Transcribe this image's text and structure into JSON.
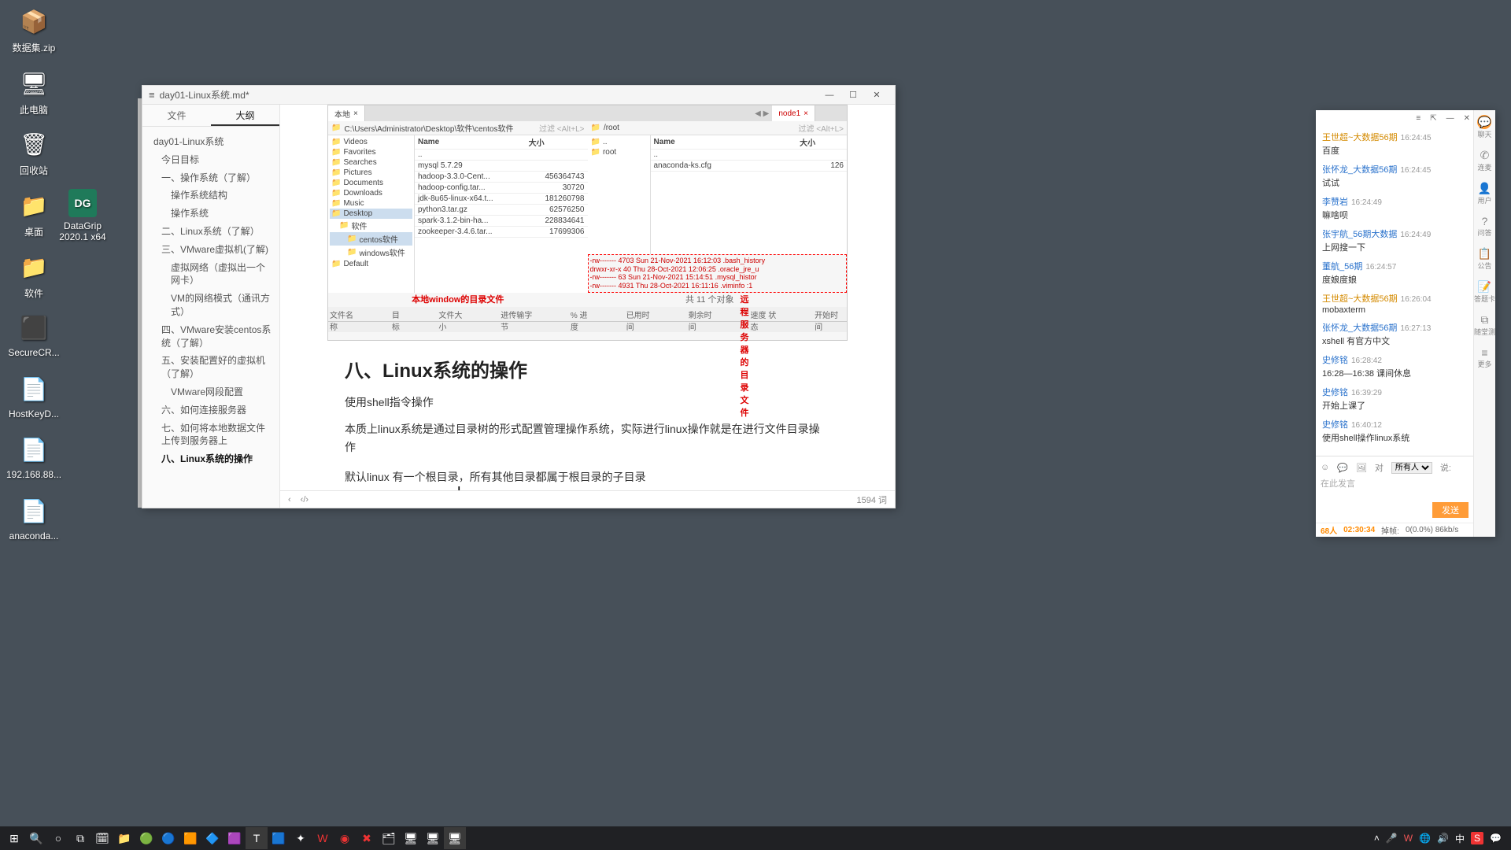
{
  "desktop": {
    "icons": [
      {
        "label": "数据集.zip",
        "glyph": "📦"
      },
      {
        "label": "此电脑",
        "glyph": "🖥"
      },
      {
        "label": "回收站",
        "glyph": "🗑"
      },
      {
        "label": "软件",
        "glyph": "📁"
      },
      {
        "label": "SecureCR...",
        "glyph": "⬛"
      },
      {
        "label": "HostKeyD...",
        "glyph": "📄"
      },
      {
        "label": "192.168.88...",
        "glyph": "📄"
      },
      {
        "label": "anaconda...",
        "glyph": "📄"
      },
      {
        "label": "桌面",
        "glyph": "📁"
      },
      {
        "label": "DataGrip 2020.1 x64",
        "glyph": "DG"
      }
    ]
  },
  "typora": {
    "title": "day01-Linux系统.md*",
    "tabs": {
      "file": "文件",
      "outline": "大纲"
    },
    "outline": [
      {
        "level": 0,
        "text": "day01-Linux系统"
      },
      {
        "level": 1,
        "text": "今日目标"
      },
      {
        "level": 1,
        "text": "一、操作系统（了解）"
      },
      {
        "level": 2,
        "text": "操作系统结构"
      },
      {
        "level": 2,
        "text": "操作系统"
      },
      {
        "level": 1,
        "text": "二、Linux系统（了解）"
      },
      {
        "level": 1,
        "text": "三、VMware虚拟机(了解)"
      },
      {
        "level": 2,
        "text": "虚拟网络（虚拟出一个网卡）"
      },
      {
        "level": 2,
        "text": "VM的网络模式（通讯方式）"
      },
      {
        "level": 1,
        "text": "四、VMware安装centos系统（了解）"
      },
      {
        "level": 1,
        "text": "五、安装配置好的虚拟机（了解）"
      },
      {
        "level": 2,
        "text": "VMware网段配置"
      },
      {
        "level": 1,
        "text": "六、如何连接服务器"
      },
      {
        "level": 1,
        "text": "七、如何将本地数据文件上传到服务器上"
      },
      {
        "level": 1,
        "text": "八、Linux系统的操作",
        "active": true
      }
    ],
    "image": {
      "leftTab": "本地",
      "rightTab": "node1",
      "leftPath": "C:\\Users\\Administrator\\Desktop\\软件\\centos软件",
      "rightPath": "/root",
      "filterHint": "过滤 <Alt+L>",
      "leftFolders": [
        "Videos",
        "Favorites",
        "Searches",
        "Pictures",
        "Documents",
        "Downloads",
        "Music",
        "Desktop",
        "软件",
        "centos软件",
        "windows软件",
        "Default"
      ],
      "leftCols": {
        "name": "Name",
        "size": "大小"
      },
      "leftFiles": [
        {
          "name": "..",
          "size": ""
        },
        {
          "name": "mysql 5.7.29",
          "size": ""
        },
        {
          "name": "hadoop-3.3.0-Cent...",
          "size": "456364743"
        },
        {
          "name": "hadoop-config.tar...",
          "size": "30720"
        },
        {
          "name": "jdk-8u65-linux-x64.t...",
          "size": "181260798"
        },
        {
          "name": "python3.tar.gz",
          "size": "62576250"
        },
        {
          "name": "spark-3.1.2-bin-ha...",
          "size": "228834641"
        },
        {
          "name": "zookeeper-3.4.6.tar...",
          "size": "17699306"
        }
      ],
      "rightCols": {
        "name": "Name",
        "size": "大小"
      },
      "rightFiles": [
        {
          "name": "..",
          "size": ""
        },
        {
          "name": "root",
          "size": ""
        },
        {
          "name": "anaconda-ks.cfg",
          "size": "126"
        }
      ],
      "rightLog": [
        "-rw-------   4703 Sun 21-Nov-2021 16:12:03 .bash_history",
        "drwxr-xr-x     40 Thu 28-Oct-2021 12:06:25 .oracle_jre_u",
        "-rw-------     63 Sun 21-Nov-2021 15:14:51 .mysql_histor",
        "-rw-------   4931 Thu 28-Oct-2021 16:11:16 .viminfo :1"
      ],
      "captionLeft": "本地window的目录文件",
      "captionRightA": "共 11 个对象",
      "captionRightB": "远程服务器的目录文件",
      "statusHdr": [
        "文件名称",
        "目标",
        "文件大小",
        "进传输字节",
        "% 进度",
        "已用时间",
        "剩余时间",
        "速度 状态",
        "开始时间"
      ]
    },
    "content": {
      "heading": "八、Linux系统的操作",
      "p1": "使用shell指令操作",
      "p2": "本质上linux系统是通过目录树的形式配置管理操作系统，实际进行linux操作就是在进行文件目录操作",
      "p3": "默认linux 有一个根目录，所有其他目录都属于根目录的子目录"
    },
    "footer": {
      "wordcount": "1594 词"
    }
  },
  "chat": {
    "titlebar": {
      "more": "≡",
      "expand": "⇱",
      "min": "—",
      "close": "✕"
    },
    "messages": [
      {
        "sender": "王世超~大数据56期",
        "cls": "orange",
        "time": "16:24:45",
        "text": "百度"
      },
      {
        "sender": "张怀龙_大数据56期",
        "cls": "",
        "time": "16:24:45",
        "text": "试试"
      },
      {
        "sender": "李赞岩",
        "cls": "",
        "time": "16:24:49",
        "text": "嘛啥呗"
      },
      {
        "sender": "张宇航_56期大数据",
        "cls": "",
        "time": "16:24:49",
        "text": "上网搜一下"
      },
      {
        "sender": "董航_56期",
        "cls": "",
        "time": "16:24:57",
        "text": "度娘度娘"
      },
      {
        "sender": "王世超~大数据56期",
        "cls": "orange",
        "time": "16:26:04",
        "text": "mobaxterm"
      },
      {
        "sender": "张怀龙_大数据56期",
        "cls": "",
        "time": "16:27:13",
        "text": "xshell  有官方中文"
      },
      {
        "sender": "史修铭",
        "cls": "",
        "time": "16:28:42",
        "text": "16:28—16:38  课间休息"
      },
      {
        "sender": "史修铭",
        "cls": "",
        "time": "16:39:29",
        "text": "开始上课了"
      },
      {
        "sender": "史修铭",
        "cls": "",
        "time": "16:40:12",
        "text": "使用shell操作linux系统"
      }
    ],
    "input": {
      "toLabel": "对",
      "target": "所有人",
      "sayLabel": "说:",
      "placeholder": "在此发言",
      "send": "发送"
    },
    "status": {
      "people": "68人",
      "elapsed": "02:30:34",
      "dropLabel": "掉帧:",
      "drop": "0(0.0%) 86kb/s"
    },
    "side": [
      {
        "icon": "💬",
        "label": "聊天",
        "active": true
      },
      {
        "icon": "✆",
        "label": "连麦"
      },
      {
        "icon": "👤",
        "label": "用户"
      },
      {
        "icon": "?",
        "label": "问答"
      },
      {
        "icon": "📋",
        "label": "公告"
      },
      {
        "icon": "📝",
        "label": "答题卡"
      },
      {
        "icon": "⧉",
        "label": "随堂测"
      },
      {
        "icon": "≡",
        "label": "更多"
      }
    ]
  },
  "taskbar": {
    "left": [
      "⊞",
      "🔍",
      "○",
      "⧉",
      "🗓",
      "📁",
      "🌐",
      "🌐",
      "🔲",
      "🔧",
      "📘",
      "T",
      "f",
      "✦",
      "W",
      "◉",
      "✖",
      "🗂",
      "🖥",
      "🖥",
      "🖥"
    ],
    "tray": {
      "ime": "中",
      "sogou": "S",
      "notif": "💬"
    }
  }
}
